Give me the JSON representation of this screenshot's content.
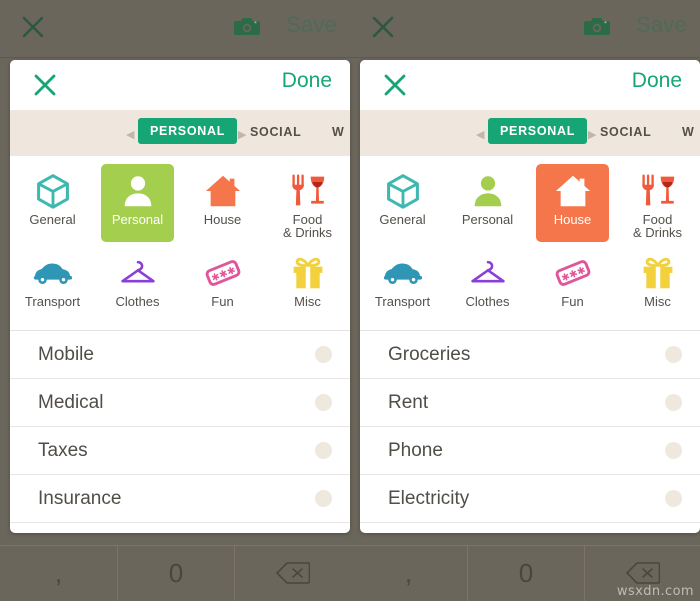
{
  "background_app": {
    "close_icon": "close-x-icon",
    "camera_icon": "camera-icon",
    "save_label": "Save",
    "keypad": {
      "keys": [
        {
          "label": ",",
          "name": "comma-key"
        },
        {
          "label": "0",
          "name": "zero-key"
        },
        {
          "label": "⌫",
          "name": "backspace-key"
        }
      ]
    },
    "watermark": "wsxdn.com"
  },
  "panels": [
    {
      "id": "left",
      "header": {
        "close_icon": "close-x-icon",
        "done_label": "Done"
      },
      "tabs": {
        "prev_arrow": "◀",
        "next_arrow": "▶",
        "items": [
          {
            "label": "PERSONAL",
            "active": true
          },
          {
            "label": "SOCIAL",
            "active": false
          },
          {
            "label": "W",
            "active": false
          }
        ]
      },
      "categories": [
        {
          "label": "General",
          "icon": "cube-icon",
          "color": "#3fb8b0",
          "selected": false
        },
        {
          "label": "Personal",
          "icon": "person-icon",
          "color": "#a4ce4e",
          "selected": true
        },
        {
          "label": "House",
          "icon": "house-icon",
          "color": "#f4764a",
          "selected": false
        },
        {
          "label": "Food\n& Drinks",
          "icon": "food-drinks-icon",
          "color": "#f05a3c",
          "selected": false
        },
        {
          "label": "Transport",
          "icon": "car-icon",
          "color": "#2f97b5",
          "selected": false
        },
        {
          "label": "Clothes",
          "icon": "hanger-icon",
          "color": "#8b3fd8",
          "selected": false
        },
        {
          "label": "Fun",
          "icon": "ticket-icon",
          "color": "#e0569a",
          "selected": false
        },
        {
          "label": "Misc",
          "icon": "gift-icon",
          "color": "#f2d13c",
          "selected": false
        }
      ],
      "list": [
        {
          "label": "Mobile"
        },
        {
          "label": "Medical"
        },
        {
          "label": "Taxes"
        },
        {
          "label": "Insurance"
        }
      ]
    },
    {
      "id": "right",
      "header": {
        "close_icon": "close-x-icon",
        "done_label": "Done"
      },
      "tabs": {
        "prev_arrow": "◀",
        "next_arrow": "▶",
        "items": [
          {
            "label": "PERSONAL",
            "active": true
          },
          {
            "label": "SOCIAL",
            "active": false
          },
          {
            "label": "W",
            "active": false
          }
        ]
      },
      "categories": [
        {
          "label": "General",
          "icon": "cube-icon",
          "color": "#3fb8b0",
          "selected": false
        },
        {
          "label": "Personal",
          "icon": "person-icon",
          "color": "#a4ce4e",
          "selected": false
        },
        {
          "label": "House",
          "icon": "house-icon",
          "color": "#f4764a",
          "selected": true
        },
        {
          "label": "Food\n& Drinks",
          "icon": "food-drinks-icon",
          "color": "#f05a3c",
          "selected": false
        },
        {
          "label": "Transport",
          "icon": "car-icon",
          "color": "#2f97b5",
          "selected": false
        },
        {
          "label": "Clothes",
          "icon": "hanger-icon",
          "color": "#8b3fd8",
          "selected": false
        },
        {
          "label": "Fun",
          "icon": "ticket-icon",
          "color": "#e0569a",
          "selected": false
        },
        {
          "label": "Misc",
          "icon": "gift-icon",
          "color": "#f2d13c",
          "selected": false
        }
      ],
      "list": [
        {
          "label": "Groceries"
        },
        {
          "label": "Rent"
        },
        {
          "label": "Phone"
        },
        {
          "label": "Electricity"
        }
      ]
    }
  ],
  "theme": {
    "accent_green": "#16a676",
    "tabstrip_bg": "#efe7dd",
    "scrim": "#6b665c",
    "scrollbar": "#2d6047",
    "selected_personal": "#a4ce4e",
    "selected_house": "#f4764a"
  }
}
